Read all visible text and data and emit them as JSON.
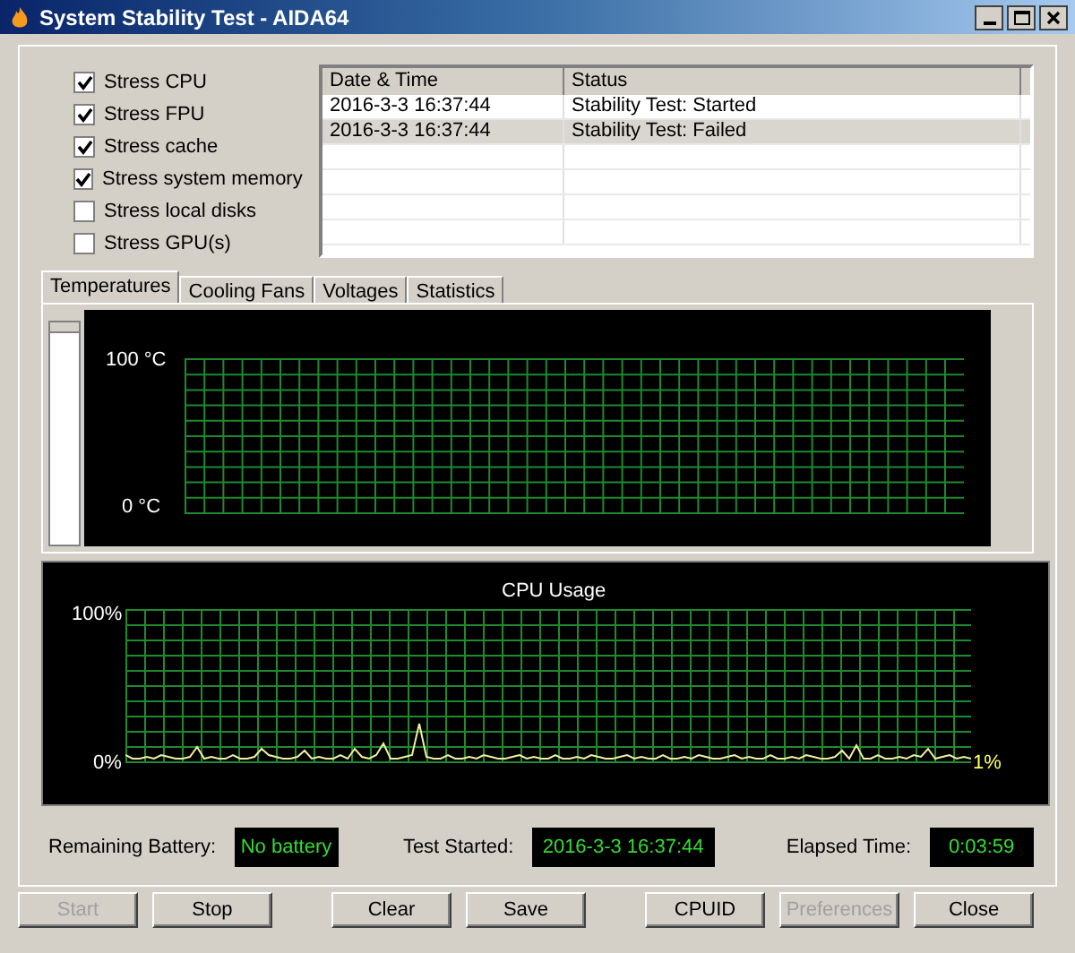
{
  "window": {
    "title": "System Stability Test - AIDA64"
  },
  "stress_options": [
    {
      "label": "Stress CPU",
      "checked": true
    },
    {
      "label": "Stress FPU",
      "checked": true
    },
    {
      "label": "Stress cache",
      "checked": true
    },
    {
      "label": "Stress system memory",
      "checked": true
    },
    {
      "label": "Stress local disks",
      "checked": false
    },
    {
      "label": "Stress GPU(s)",
      "checked": false
    }
  ],
  "log": {
    "columns": [
      "Date & Time",
      "Status"
    ],
    "rows": [
      {
        "cells": [
          "2016-3-3 16:37:44",
          "Stability Test: Started"
        ],
        "selected": false
      },
      {
        "cells": [
          "2016-3-3 16:37:44",
          "Stability Test: Failed"
        ],
        "selected": true
      }
    ]
  },
  "tabs": [
    {
      "label": "Temperatures",
      "selected": true
    },
    {
      "label": "Cooling Fans",
      "selected": false
    },
    {
      "label": "Voltages",
      "selected": false
    },
    {
      "label": "Statistics",
      "selected": false
    }
  ],
  "temperature_graph": {
    "top_label": "100 °C",
    "bottom_label": "0 °C"
  },
  "cpu_graph": {
    "title": "CPU Usage",
    "top_label": "100%",
    "bottom_label": "0%",
    "current": "1%"
  },
  "status": [
    {
      "label": "Remaining Battery:",
      "value": "No battery"
    },
    {
      "label": "Test Started:",
      "value": "2016-3-3 16:37:44"
    },
    {
      "label": "Elapsed Time:",
      "value": "0:03:59"
    }
  ],
  "buttons": [
    {
      "label": "Start",
      "disabled": true
    },
    {
      "label": "Stop",
      "disabled": false
    },
    {
      "label": "Clear",
      "disabled": false
    },
    {
      "label": "Save",
      "disabled": false
    },
    {
      "label": "CPUID",
      "disabled": false
    },
    {
      "label": "Preferences",
      "disabled": true
    },
    {
      "label": "Close",
      "disabled": false
    }
  ]
}
